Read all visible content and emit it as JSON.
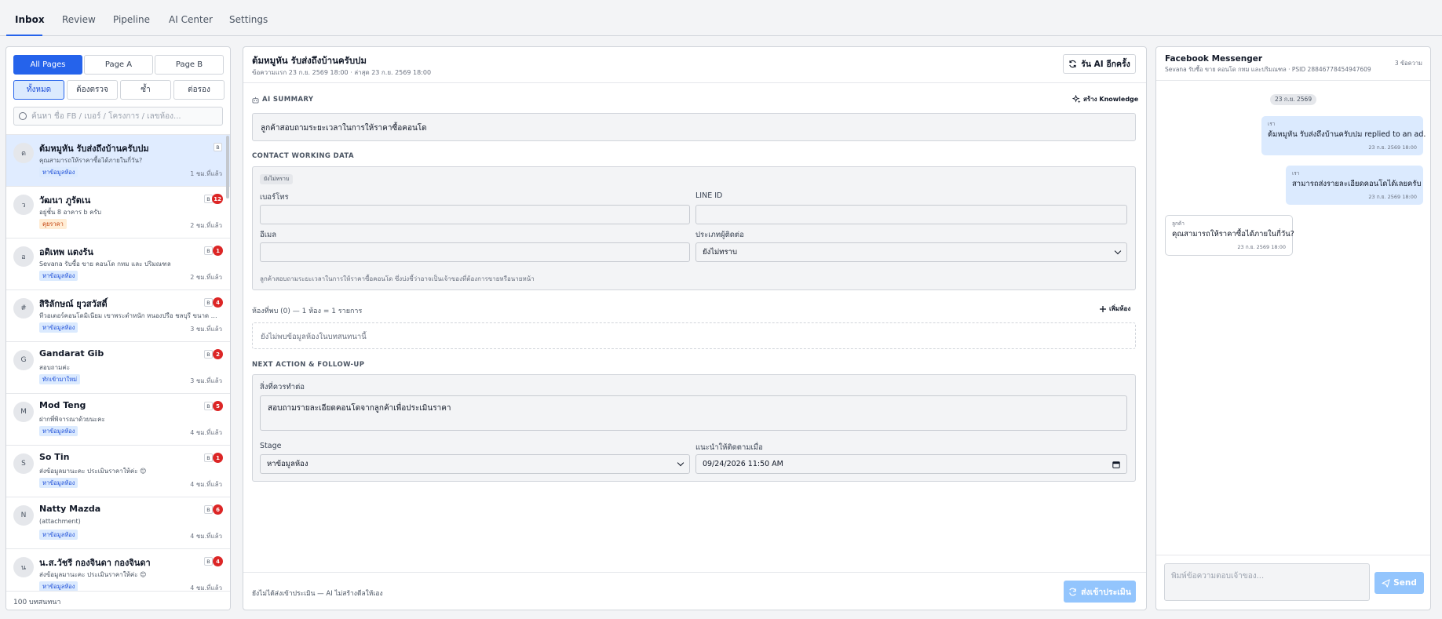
{
  "nav": {
    "tabs": [
      {
        "label": "Inbox"
      },
      {
        "label": "Review"
      },
      {
        "label": "Pipeline"
      },
      {
        "label": "AI Center"
      },
      {
        "label": "Settings"
      }
    ]
  },
  "left": {
    "pages": [
      "All Pages",
      "Page A",
      "Page B"
    ],
    "filters": [
      "ทั้งหมด",
      "ต้องตรวจ",
      "ซ้ำ",
      "ต่อรอง"
    ],
    "search_placeholder": "ค้นหา ชื่อ FB / เบอร์ / โครงการ / เลขห้อง...",
    "conversations": [
      {
        "avatar": "ต",
        "name": "ต้มหมูหัน รับส่งถึงบ้านครับปม",
        "preview": "คุณสามารถให้ราคาซื้อได้ภายในกี่วัน?",
        "tag": "หาข้อมูลห้อง",
        "time": "1 ชม.ที่แล้ว",
        "page": "B",
        "badge": ""
      },
      {
        "avatar": "ว",
        "name": "วัฒนา ภูรัตเน",
        "preview": "อยู่ชั้น 8 อาคาร b ครับ",
        "tag": "คุยราคา",
        "time": "2 ชม.ที่แล้ว",
        "page": "B",
        "badge": "12"
      },
      {
        "avatar": "อ",
        "name": "อดิเทพ แตงร้น",
        "preview": "Sevana รับซื้อ ขาย คอนโด กทม และ ปริมณฑล",
        "tag": "หาข้อมูลห้อง",
        "time": "2 ชม.ที่แล้ว",
        "page": "B",
        "badge": "1"
      },
      {
        "avatar": "#",
        "name": "สิริลักษณ์ ยุวสวัสดิ์",
        "preview": "ทีวอเตอร์คอนโดมิเนียม เขาพระตำหนัก หนองปรือ ชลบุรี ขนาด 65...",
        "tag": "หาข้อมูลห้อง",
        "time": "3 ชม.ที่แล้ว",
        "page": "B",
        "badge": "4"
      },
      {
        "avatar": "G",
        "name": "Gandarat Gib",
        "preview": "สอบถามค่ะ",
        "tag": "ทักเข้ามาใหม่",
        "time": "3 ชม.ที่แล้ว",
        "page": "B",
        "badge": "2"
      },
      {
        "avatar": "M",
        "name": "Mod Teng",
        "preview": "ฝากพี่พิจารณาด้วยนะคะ",
        "tag": "หาข้อมูลห้อง",
        "time": "4 ชม.ที่แล้ว",
        "page": "B",
        "badge": "5"
      },
      {
        "avatar": "S",
        "name": "So Tin",
        "preview": "ส่งข้อมูลมานะคะ ประเมินราคาให้ค่ะ 😊",
        "tag": "หาข้อมูลห้อง",
        "time": "4 ชม.ที่แล้ว",
        "page": "B",
        "badge": "1"
      },
      {
        "avatar": "N",
        "name": "Natty Mazda",
        "preview": "(attachment)",
        "tag": "หาข้อมูลห้อง",
        "time": "4 ชม.ที่แล้ว",
        "page": "B",
        "badge": "6"
      },
      {
        "avatar": "น",
        "name": "น.ส.วัชรี กองจินดา กองจินดา",
        "preview": "ส่งข้อมูลมานะคะ ประเมินราคาให้ค่ะ 😊",
        "tag": "หาข้อมูลห้อง",
        "time": "4 ชม.ที่แล้ว",
        "page": "B",
        "badge": "4"
      }
    ],
    "footer": "100 บทสนทนา"
  },
  "center": {
    "title": "ต้มหมูหัน รับส่งถึงบ้านครับปม",
    "subtitle": "ข้อความแรก 23 ก.ย. 2569 18:00 · ล่าสุด 23 ก.ย. 2569 18:00",
    "ai_button": "รัน AI อีกครั้ง",
    "ai_summary_label": "AI SUMMARY",
    "knowledge_button": "สร้าง Knowledge",
    "ai_summary_text": "ลูกค้าสอบถามระยะเวลาในการให้ราคาซื้อคอนโด",
    "contact_label": "CONTACT WORKING DATA",
    "contact_badge": "ยังไม่ทราบ",
    "phone_label": "เบอร์โทร",
    "phone_value": "",
    "line_label": "LINE ID",
    "line_value": "",
    "email_label": "อีเมล",
    "email_value": "",
    "contact_type_label": "ประเภทผู้ติดต่อ",
    "contact_type_value": "ยังไม่ทราบ",
    "contact_note": "ลูกค้าสอบถามระยะเวลาในการให้ราคาซื้อคอนโด ซึ่งบ่งชี้ว่าอาจเป็นเจ้าของที่ต้องการขายหรือนายหน้า",
    "rooms_label": "ห้องที่พบ (0) — 1 ห้อง = 1 รายการ",
    "add_room_button": "เพิ่มห้อง",
    "rooms_empty": "ยังไม่พบข้อมูลห้องในบทสนทนานี้",
    "next_label": "NEXT ACTION & FOLLOW-UP",
    "next_todo_label": "สิ่งที่ควรทำต่อ",
    "next_todo_value": "สอบถามรายละเอียดคอนโดจากลูกค้าเพื่อประเมินราคา",
    "stage_label": "Stage",
    "stage_value": "หาข้อมูลห้อง",
    "followup_label": "แนะนำให้ติดตามเมื่อ",
    "followup_value": "09/24/2026 11:50 AM",
    "footer_note": "ยังไม่ได้ส่งเข้าประเมิน — AI ไม่สร้างดีลให้เอง",
    "submit_button": "ส่งเข้าประเมิน"
  },
  "right": {
    "title": "Facebook Messenger",
    "subtitle": "Sevana รับซื้อ ขาย คอนโด กทม และปริมณฑล · PSID 28846778454947609",
    "count": "3 ข้อความ",
    "date_pill": "23 ก.ย. 2569",
    "messages": [
      {
        "who": "เรา",
        "text": "ต้มหมูหัน รับส่งถึงบ้านครับปม replied to an ad.",
        "time": "23 ก.ย. 2569 18:00"
      },
      {
        "who": "เรา",
        "text": "สามารถส่งรายละเอียดคอนโดได้เลยครับ",
        "time": "23 ก.ย. 2569 18:00"
      },
      {
        "who": "ลูกค้า",
        "text": "คุณสามารถให้ราคาซื้อได้ภายในกี่วัน?",
        "time": "23 ก.ย. 2569 18:00"
      }
    ],
    "compose_placeholder": "พิมพ์ข้อความตอบเจ้าของ...",
    "send_button": "Send"
  },
  "colors": {
    "accent": "#2563eb",
    "badge_red": "#dc2626",
    "selected_row": "#e0ecff",
    "light_button": "#93c5fd"
  },
  "icons": [
    "search-icon",
    "refresh-icon",
    "sparkle-icon",
    "robot-icon",
    "plus-icon",
    "chevron-down-icon",
    "calendar-icon",
    "send-icon",
    "submit-icon"
  ]
}
